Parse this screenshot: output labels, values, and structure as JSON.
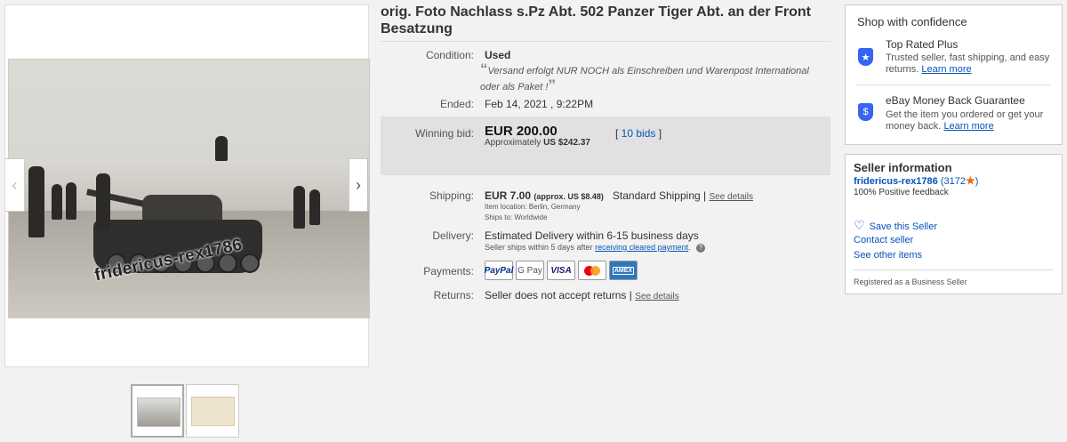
{
  "listing": {
    "title": "orig. Foto Nachlass s.Pz Abt. 502 Panzer Tiger Abt. an der Front Besatzung",
    "watermark": "fridericus-rex1786"
  },
  "details": {
    "condition_label": "Condition:",
    "condition_value": "Used",
    "condition_note": "Versand erfolgt NUR NOCH als Einschreiben und Warenpost International oder als Paket !",
    "ended_label": "Ended:",
    "ended_value": "Feb 14, 2021 , 9:22PM",
    "bid_label": "Winning bid:",
    "bid_price": "EUR 200.00",
    "bid_approx_prefix": "Approximately",
    "bid_approx_value": "US $242.37",
    "bids_text": "10 bids",
    "shipping_label": "Shipping:",
    "shipping_price": "EUR 7.00",
    "shipping_approx": "(approx. US $8.48)",
    "shipping_method": "Standard Shipping",
    "see_details": "See details",
    "item_location": "Item location:  Berlin, Germany",
    "ships_to": "Ships to:  Worldwide",
    "delivery_label": "Delivery:",
    "delivery_value": "Estimated Delivery within 6-15 business days",
    "delivery_note": "Seller ships within 5 days after",
    "delivery_link": "receiving cleared payment",
    "payments_label": "Payments:",
    "payments": [
      "PayPal",
      "G Pay",
      "VISA",
      "MasterCard",
      "AMEX"
    ],
    "returns_label": "Returns:",
    "returns_value": "Seller does not accept returns"
  },
  "confidence": {
    "title": "Shop with confidence",
    "items": [
      {
        "head": "Top Rated Plus",
        "text": "Trusted seller, fast shipping, and easy returns.",
        "link": "Learn more"
      },
      {
        "head": "eBay Money Back Guarantee",
        "text": "Get the item you ordered or get your money back.",
        "link": "Learn more"
      }
    ]
  },
  "seller": {
    "heading": "Seller information",
    "name": "fridericus-rex1786",
    "score": "(3172",
    "score_close": ")",
    "feedback": "100% Positive feedback",
    "save": "Save this Seller",
    "contact": "Contact seller",
    "other": "See other items",
    "business": "Registered as a Business Seller"
  },
  "colors": {
    "link": "#0654ba",
    "star": "#e96b15",
    "bid_bg": "#e1e1e1"
  }
}
